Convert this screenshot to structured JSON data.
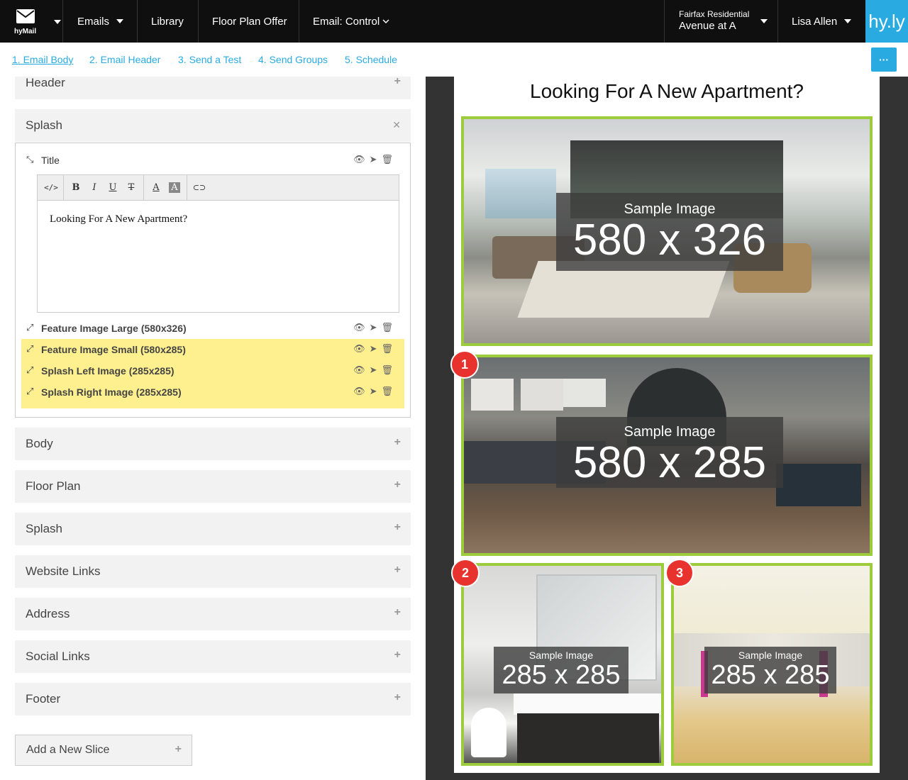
{
  "topnav": {
    "logo_label": "hyMail",
    "emails": "Emails",
    "library": "Library",
    "floor_plan_offer": "Floor Plan Offer",
    "email_control": "Email: Control",
    "property_org": "Fairfax Residential",
    "property_name": "Avenue at A",
    "user_name": "Lisa Allen",
    "brand": "hy.ly"
  },
  "steps": [
    "1. Email Body",
    "2. Email Header",
    "3. Send a Test",
    "4. Send Groups",
    "5. Schedule"
  ],
  "more_button": "···",
  "slices": {
    "header": "Header",
    "splash": "Splash",
    "body": "Body",
    "floor_plan": "Floor Plan",
    "splash2": "Splash",
    "website_links": "Website Links",
    "address": "Address",
    "social_links": "Social Links",
    "footer": "Footer"
  },
  "splash_items": {
    "title": "Title",
    "feature_large": "Feature Image Large (580x326)",
    "feature_small": "Feature Image Small (580x285)",
    "left_image": "Splash Left Image (285x285)",
    "right_image": "Splash Right Image (285x285)"
  },
  "editor": {
    "toolbar": [
      "</>",
      "B",
      "I",
      "U",
      "T",
      "A",
      "A",
      "⊂⊃"
    ],
    "text": "Looking For A New Apartment?"
  },
  "add_slice": "Add a New Slice",
  "preview": {
    "title": "Looking For A New Apartment?",
    "sample_label": "Sample Image",
    "large_dims": "580 x 326",
    "small_dims": "580 x 285",
    "left_dims": "285 x 285",
    "right_dims": "285 x 285",
    "badges": [
      "1",
      "2",
      "3"
    ]
  },
  "colors": {
    "accent": "#29abe2",
    "highlight": "#fff08f",
    "image_border": "#9ccc3c",
    "badge": "#e8322d"
  }
}
